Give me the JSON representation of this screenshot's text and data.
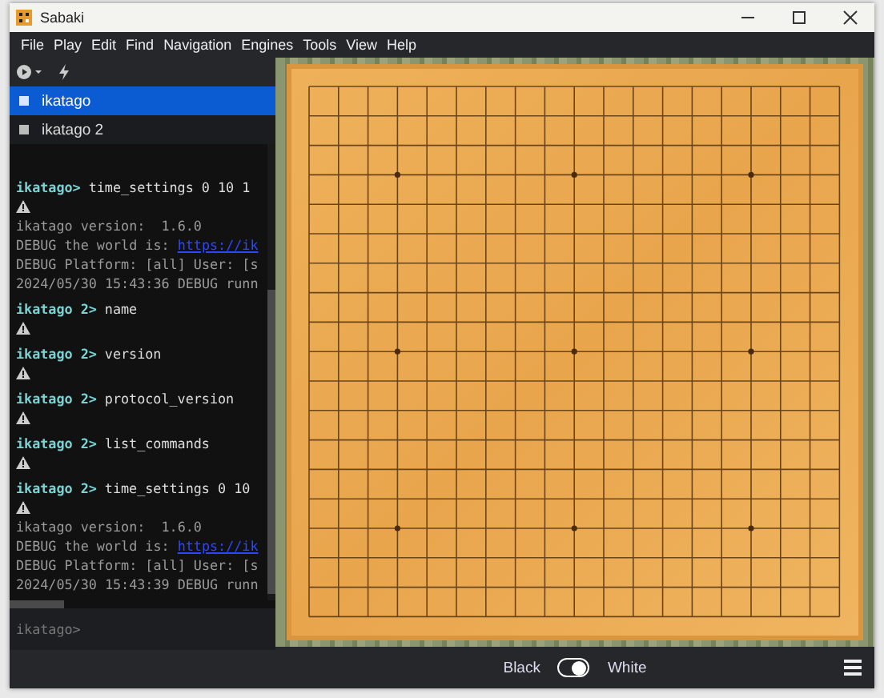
{
  "window": {
    "title": "Sabaki"
  },
  "menu": [
    "File",
    "Play",
    "Edit",
    "Find",
    "Navigation",
    "Engines",
    "Tools",
    "View",
    "Help"
  ],
  "engines": [
    {
      "label": "ikatago",
      "selected": true
    },
    {
      "label": "ikatago 2",
      "selected": false
    }
  ],
  "console": [
    {
      "prompt": "ikatago>",
      "command": "time_settings 0 10 1",
      "warning": true,
      "output": [
        {
          "text": "ikatago version:  1.6.0"
        },
        {
          "text": "DEBUG the world is: ",
          "link": "https://ik"
        },
        {
          "text": "DEBUG Platform: [all] User: [s"
        },
        {
          "text": "2024/05/30 15:43:36 DEBUG runn"
        }
      ]
    },
    {
      "prompt": "ikatago 2>",
      "command": "name",
      "warning": true
    },
    {
      "prompt": "ikatago 2>",
      "command": "version",
      "warning": true
    },
    {
      "prompt": "ikatago 2>",
      "command": "protocol_version",
      "warning": true
    },
    {
      "prompt": "ikatago 2>",
      "command": "list_commands",
      "warning": true
    },
    {
      "prompt": "ikatago 2>",
      "command": "time_settings 0 10",
      "warning": true,
      "output": [
        {
          "text": "ikatago version:  1.6.0"
        },
        {
          "text": "DEBUG the world is: ",
          "link": "https://ik"
        },
        {
          "text": "DEBUG Platform: [all] User: [s"
        },
        {
          "text": "2024/05/30 15:43:39 DEBUG runn"
        }
      ]
    }
  ],
  "console_input": {
    "placeholder": "ikatago>"
  },
  "footer": {
    "black_label": "Black",
    "white_label": "White",
    "toggle_on": true
  }
}
